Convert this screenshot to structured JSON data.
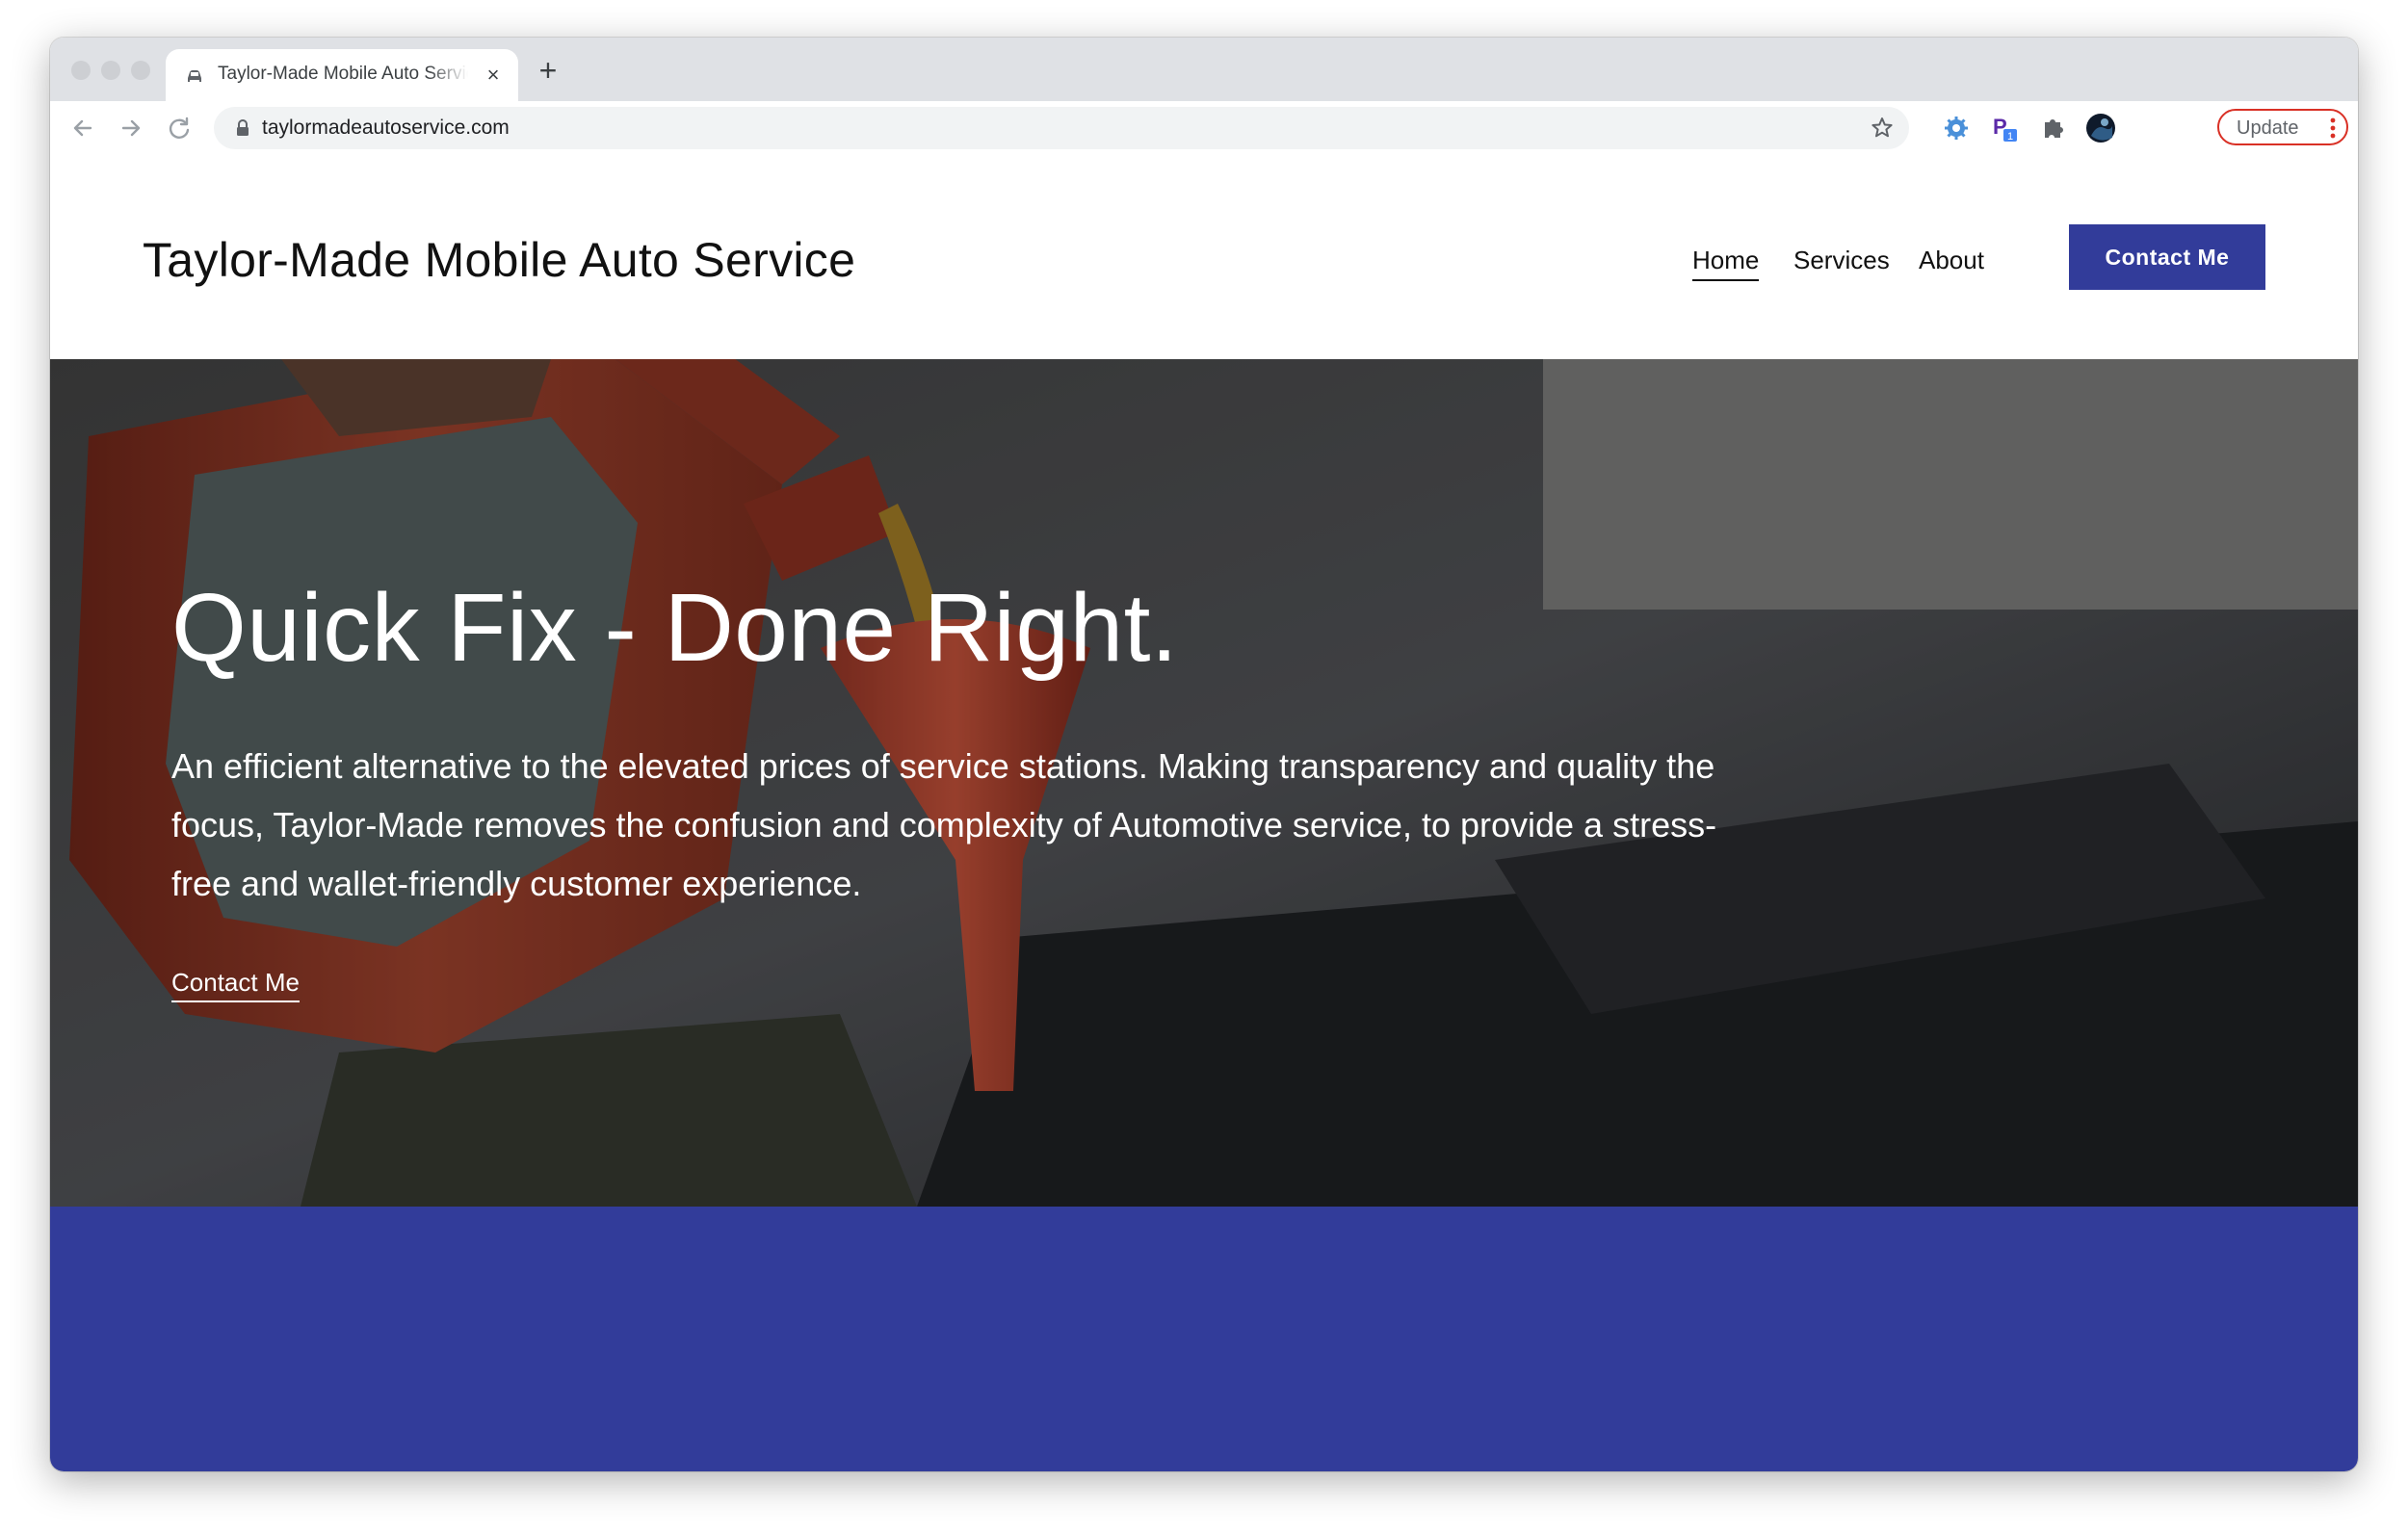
{
  "browser": {
    "tab_title": "Taylor-Made Mobile Auto Service",
    "tab_close": "×",
    "new_tab": "+",
    "url": "taylormadeautoservice.com",
    "update_label": "Update",
    "extension_badge": "1",
    "extension_letter": "P"
  },
  "site": {
    "title": "Taylor-Made Mobile Auto Service",
    "nav": [
      {
        "label": "Home",
        "active": true
      },
      {
        "label": "Services",
        "active": false
      },
      {
        "label": "About",
        "active": false
      }
    ],
    "cta_label": "Contact Me"
  },
  "hero": {
    "heading": "Quick Fix - Done Right.",
    "body": "An efficient alternative to the elevated prices of service stations. Making transparency and quality the focus, Taylor-Made removes the confusion and complexity of Automotive service, to provide a stress-free and wallet-friendly customer experience.",
    "link_label": "Contact Me"
  },
  "colors": {
    "brand_blue": "#323c9a",
    "update_border": "#d93025"
  },
  "icons": [
    "back-arrow-icon",
    "forward-arrow-icon",
    "reload-icon",
    "lock-icon",
    "star-icon",
    "extension-gear-icon",
    "extension-p-icon",
    "puzzle-icon",
    "profile-avatar-icon",
    "kebab-menu-icon"
  ]
}
